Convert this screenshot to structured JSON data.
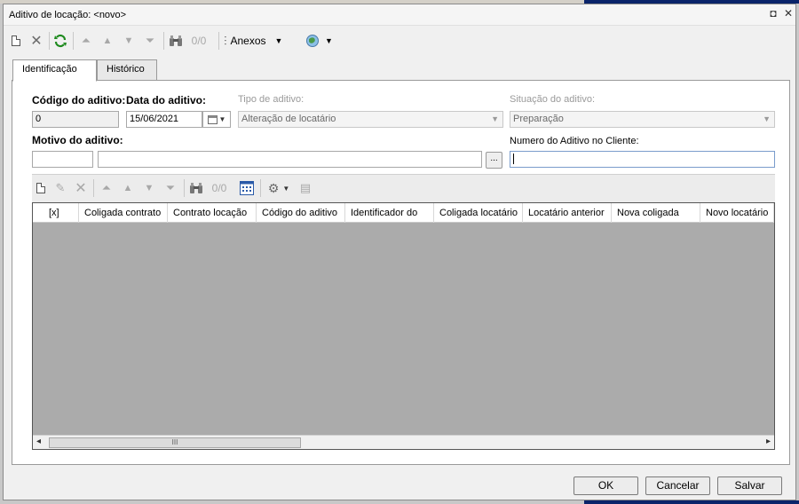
{
  "window": {
    "title": "Aditivo de locação: <novo>",
    "restore_glyph": "◘",
    "close_glyph": "✕"
  },
  "toolbar": {
    "counter": "0/0",
    "attachments_label": "Anexos"
  },
  "tabs": [
    {
      "label": "Identificação",
      "active": true
    },
    {
      "label": "Histórico",
      "active": false
    }
  ],
  "form": {
    "codigo_label": "Código do aditivo:",
    "codigo_value": "0",
    "data_label": "Data do aditivo:",
    "data_value": "15/06/2021",
    "tipo_label": "Tipo de aditivo:",
    "tipo_value": "Alteração de locatário",
    "situacao_label": "Situação do aditivo:",
    "situacao_value": "Preparação",
    "motivo_label": "Motivo do aditivo:",
    "motivo_code_value": "",
    "motivo_desc_value": "",
    "lookup_button": "...",
    "numero_label": "Numero do Aditivo no Cliente:",
    "numero_value": ""
  },
  "grid_toolbar": {
    "counter": "0/0"
  },
  "grid": {
    "columns": [
      "[x]",
      "Coligada contrato",
      "Contrato locação",
      "Código do aditivo",
      "Identificador do",
      "Coligada locatário",
      "Locatário anterior",
      "Nova coligada",
      "Novo locatário"
    ],
    "rows": [],
    "scroll_left": "◂",
    "scroll_right": "▸",
    "thumb_grip": "III"
  },
  "footer": {
    "ok_label": "OK",
    "cancel_label": "Cancelar",
    "save_label": "Salvar"
  }
}
